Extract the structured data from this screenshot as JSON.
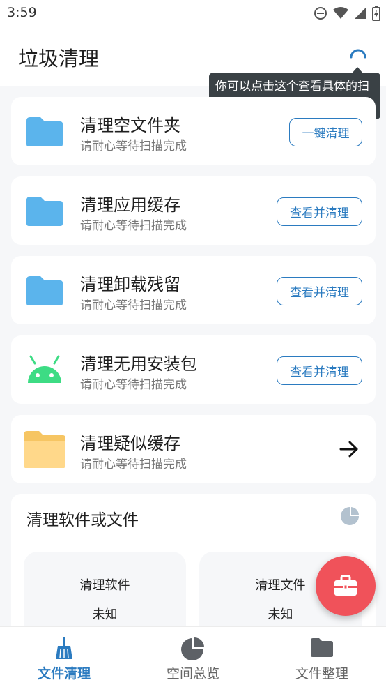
{
  "status_bar": {
    "time": "3:59"
  },
  "app_bar": {
    "title": "垃圾清理"
  },
  "tooltip": {
    "text": "你可以点击这个查看具体的扫描信息哟"
  },
  "cards": [
    {
      "title": "清理空文件夹",
      "subtitle": "请耐心等待扫描完成",
      "action": "一键清理",
      "icon": "folder-icon"
    },
    {
      "title": "清理应用缓存",
      "subtitle": "请耐心等待扫描完成",
      "action": "查看并清理",
      "icon": "folder-icon"
    },
    {
      "title": "清理卸载残留",
      "subtitle": "请耐心等待扫描完成",
      "action": "查看并清理",
      "icon": "folder-icon"
    },
    {
      "title": "清理无用安装包",
      "subtitle": "请耐心等待扫描完成",
      "action": "查看并清理",
      "icon": "android-icon"
    },
    {
      "title": "清理疑似缓存",
      "subtitle": "请耐心等待扫描完成",
      "icon": "yellow-folder-icon"
    }
  ],
  "section": {
    "title": "清理软件或文件",
    "items": [
      {
        "label": "清理软件",
        "value": "未知"
      },
      {
        "label": "清理文件",
        "value": "未知"
      }
    ]
  },
  "bottom_nav": [
    {
      "label": "文件清理",
      "icon": "broom-icon",
      "active": true
    },
    {
      "label": "空间总览",
      "icon": "pie-chart-icon",
      "active": false
    },
    {
      "label": "文件整理",
      "icon": "folder-icon",
      "active": false
    }
  ],
  "colors": {
    "accent": "#2b7bc0",
    "fab": "#f0525a",
    "folder_blue": "#5bb4ec",
    "folder_yellow": "#ffd88a",
    "android_green": "#3ddc84"
  }
}
